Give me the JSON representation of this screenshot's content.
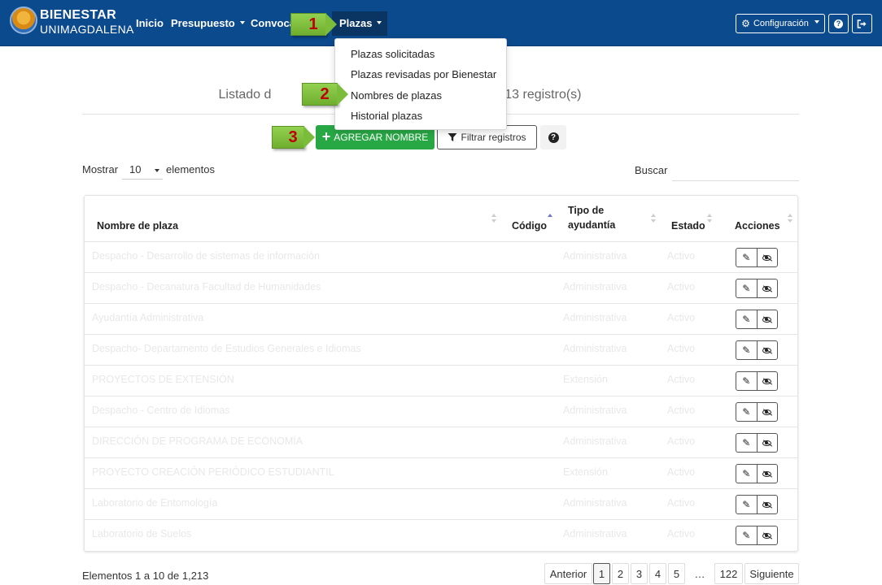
{
  "navbar": {
    "brand_line1": "BIENESTAR",
    "brand_line2": "UNIMAGDALENA",
    "items": [
      "Inicio",
      "Presupuesto",
      "Convoca",
      "Plazas"
    ],
    "config_label": "Configuración",
    "help_icon": "?",
    "logout_icon": "logout-icon",
    "bg_color": "#0c4a8e"
  },
  "callouts": [
    "1",
    "2",
    "3"
  ],
  "dropdown": {
    "items": [
      "Plazas solicitadas",
      "Plazas revisadas por Bienestar",
      "Nombres de plazas",
      "Historial plazas"
    ]
  },
  "page": {
    "title_left": "Listado d",
    "title_right": "ta con 1213 registro(s)"
  },
  "toolbar": {
    "add_label": "AGREGAR NOMBRE",
    "filter_label": "Filtrar registros",
    "help_icon": "?",
    "accent": "#28a745"
  },
  "length": {
    "prefix": "Mostrar",
    "value": "10",
    "suffix": "elementos"
  },
  "search": {
    "label": "Buscar",
    "value": ""
  },
  "table": {
    "headers": {
      "name": "Nombre de plaza",
      "code": "Código",
      "type1": "Tipo de",
      "type2": "ayudantía",
      "status": "Estado",
      "actions": "Acciones"
    },
    "rows": [
      {
        "name": "Despacho - Desarrollo de sistemas de información",
        "type": "Administrativa",
        "status": "Activo"
      },
      {
        "name": "Despacho - Decanatura Facultad de Humanidades",
        "type": "Administrativa",
        "status": "Activo"
      },
      {
        "name": "Ayudantía Administrativa",
        "type": "Administrativa",
        "status": "Activo"
      },
      {
        "name": "Despacho- Departamento de Estudios Generales e Idiomas",
        "type": "Administrativa",
        "status": "Activo"
      },
      {
        "name": "PROYECTOS DE EXTENSIÓN",
        "type": "Extensión",
        "status": "Activo"
      },
      {
        "name": "Despacho - Centro de Idiomas",
        "type": "Administrativa",
        "status": "Activo"
      },
      {
        "name": "DIRECCIÓN DE PROGRAMA DE ECONOMÍA",
        "type": "Administrativa",
        "status": "Activo"
      },
      {
        "name": "PROYECTO CREACIÓN PERIÓDICO ESTUDIANTIL",
        "type": "Extensión",
        "status": "Activo"
      },
      {
        "name": "Laboratorio de Entomología",
        "type": "Administrativa",
        "status": "Activo"
      },
      {
        "name": "Laboratorio de Suelos",
        "type": "Administrativa",
        "status": "Activo"
      }
    ]
  },
  "footer": {
    "info": "Elementos 1 a 10 de 1,213",
    "pages": [
      "Anterior",
      "1",
      "2",
      "3",
      "4",
      "5",
      "…",
      "122",
      "Siguiente"
    ],
    "current_page": "1"
  }
}
